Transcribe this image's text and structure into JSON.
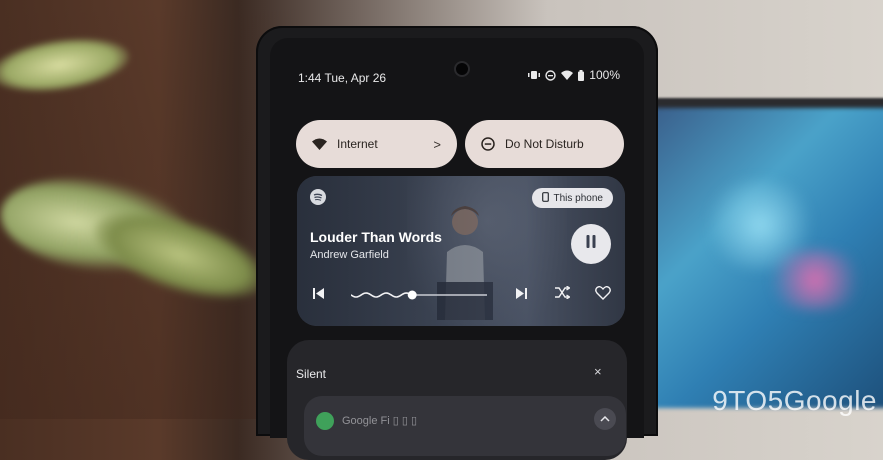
{
  "status_bar": {
    "time_date": "1:44 Tue, Apr 26",
    "battery": "100%"
  },
  "quick_tiles": [
    {
      "label": "Internet",
      "icon": "wifi-icon",
      "chevron": ">"
    },
    {
      "label": "Do Not Disturb",
      "icon": "do-not-disturb-icon"
    }
  ],
  "media": {
    "app_icon": "spotify-icon",
    "output_chip": "This phone",
    "title": "Louder Than Words",
    "artist": "Andrew Garfield",
    "progress": 0.45,
    "controls": [
      "previous-icon",
      "next-icon",
      "shuffle-icon",
      "heart-icon",
      "pause-icon"
    ],
    "accent": "#e8e8ec"
  },
  "notifications": {
    "section_label": "Silent",
    "close": "×",
    "first_item_text": "Google Fi ▯ ▯ ▯"
  },
  "watermark": "9TO5Google"
}
